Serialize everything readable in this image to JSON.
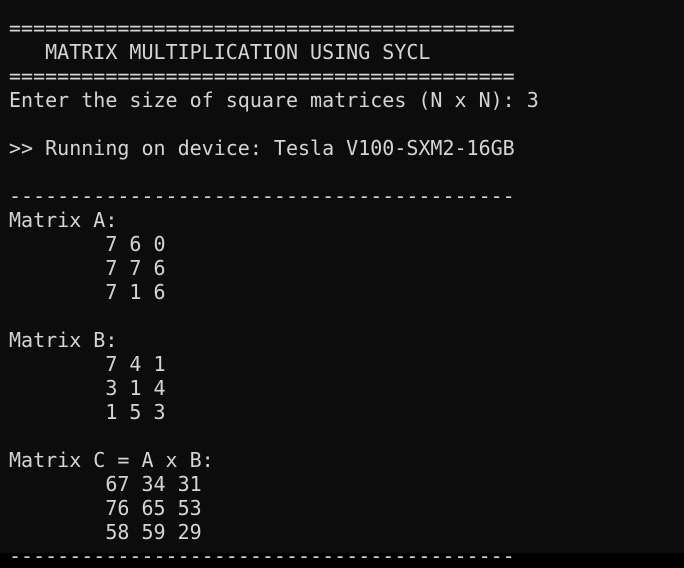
{
  "terminal": {
    "lines": [
      "",
      "==========================================",
      "   MATRIX MULTIPLICATION USING SYCL",
      "==========================================",
      "Enter the size of square matrices (N x N): 3",
      "",
      ">> Running on device: Tesla V100-SXM2-16GB",
      "",
      "------------------------------------------",
      "Matrix A:",
      "        7 6 0",
      "        7 7 6",
      "        7 1 6",
      "",
      "Matrix B:",
      "        7 4 1",
      "        3 1 4",
      "        1 5 3",
      "",
      "Matrix C = A x B:",
      "        67 34 31",
      "        76 65 53",
      "        58 59 29",
      "------------------------------------------"
    ]
  }
}
